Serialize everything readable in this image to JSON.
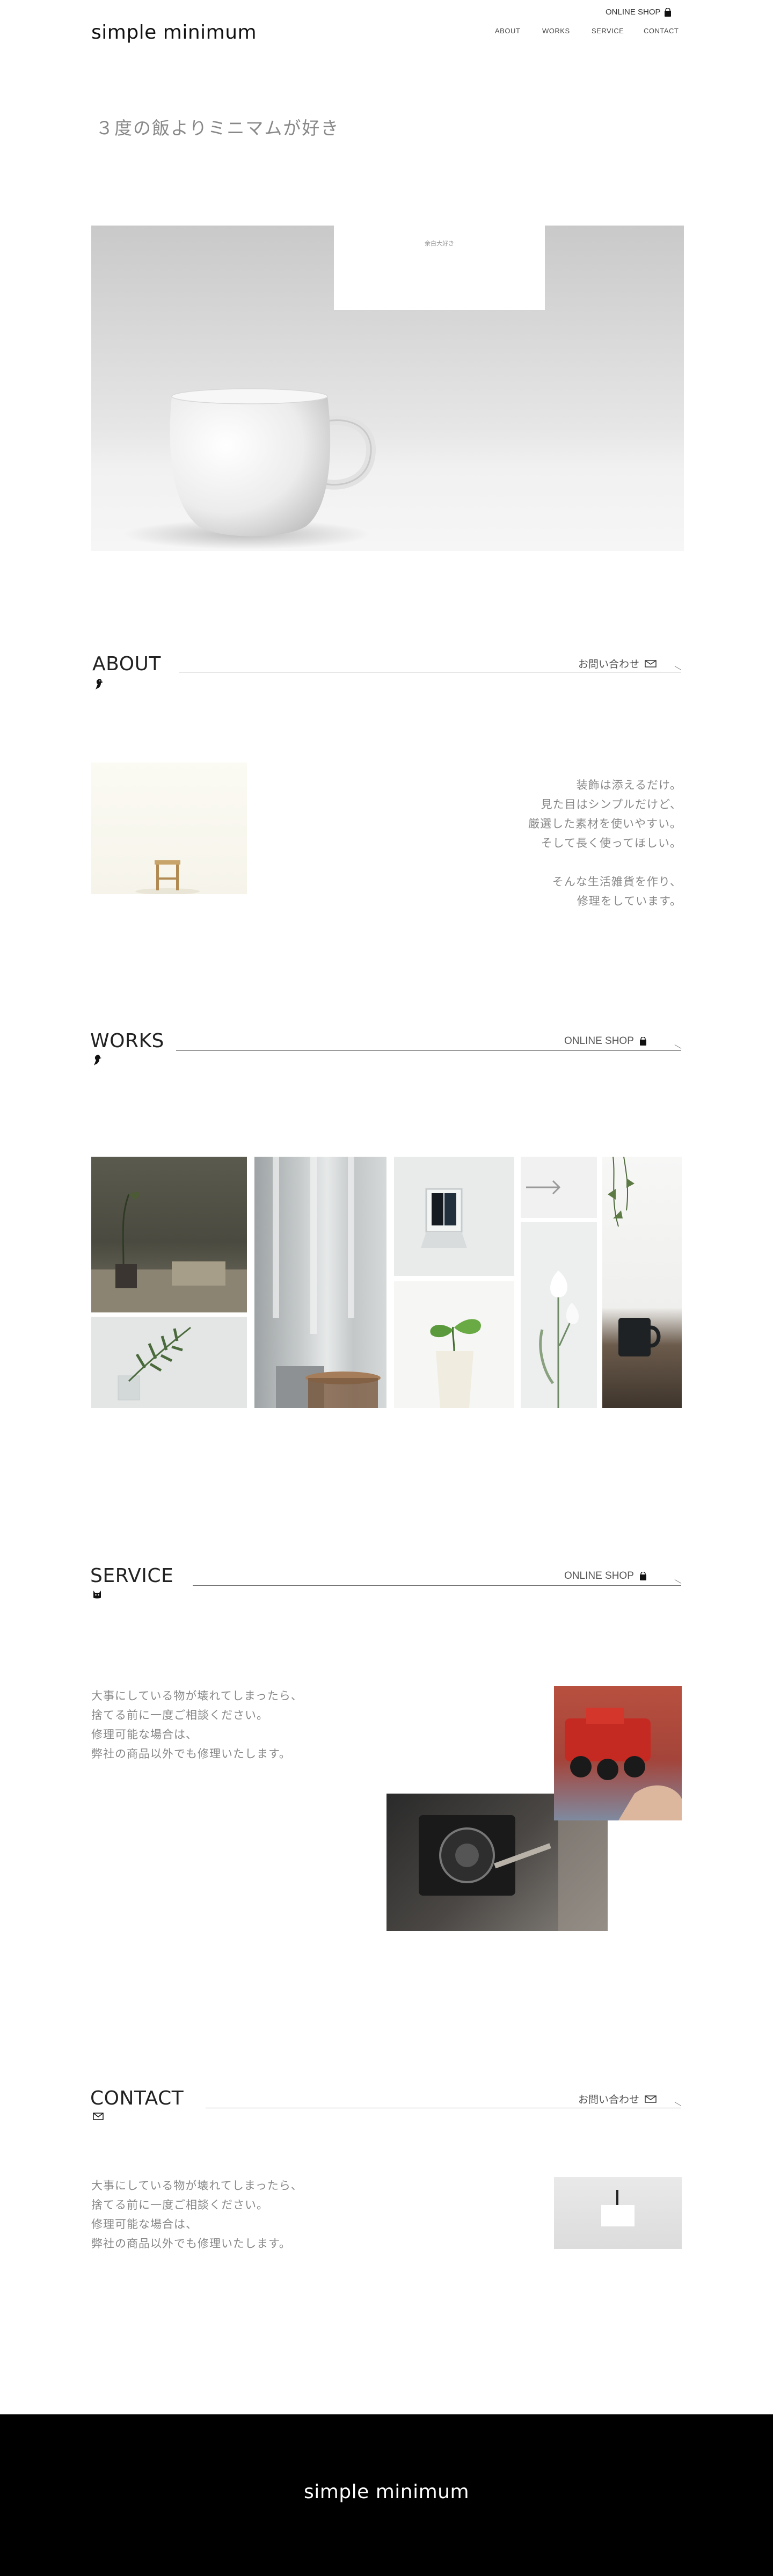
{
  "header": {
    "logo": "simple minimum",
    "online_shop": "ONLINE SHOP",
    "nav": [
      {
        "label": "ABOUT"
      },
      {
        "label": "WORKS"
      },
      {
        "label": "SERVICE"
      },
      {
        "label": "CONTACT"
      }
    ]
  },
  "tagline": "３度の飯よりミニマムが好き",
  "hero": {
    "card_text": "余白大好き"
  },
  "about": {
    "title": "ABOUT",
    "link": "お問い合わせ",
    "lines": [
      "装飾は添えるだけ。",
      "見た目はシンプルだけど、",
      "厳選した素材を使いやすい。",
      "そして長く使ってほしい。",
      "",
      "そんな生活雑貨を作り、",
      "修理をしています。"
    ]
  },
  "works": {
    "title": "WORKS",
    "link": "ONLINE SHOP"
  },
  "service": {
    "title": "SERVICE",
    "link": "ONLINE SHOP",
    "lines": [
      "大事にしている物が壊れてしまったら、",
      "捨てる前に一度ご相談ください。",
      "修理可能な場合は、",
      "弊社の商品以外でも修理いたします。"
    ]
  },
  "contact": {
    "title": "CONTACT",
    "link": "お問い合わせ",
    "lines": [
      "大事にしている物が壊れてしまったら、",
      "捨てる前に一度ご相談ください。",
      "修理可能な場合は、",
      "弊社の商品以外でも修理いたします。"
    ]
  },
  "footer": {
    "logo": "simple minimum"
  },
  "colors": {
    "footer_bg": "#000000",
    "text_gray": "#888888",
    "line": "#777777"
  }
}
